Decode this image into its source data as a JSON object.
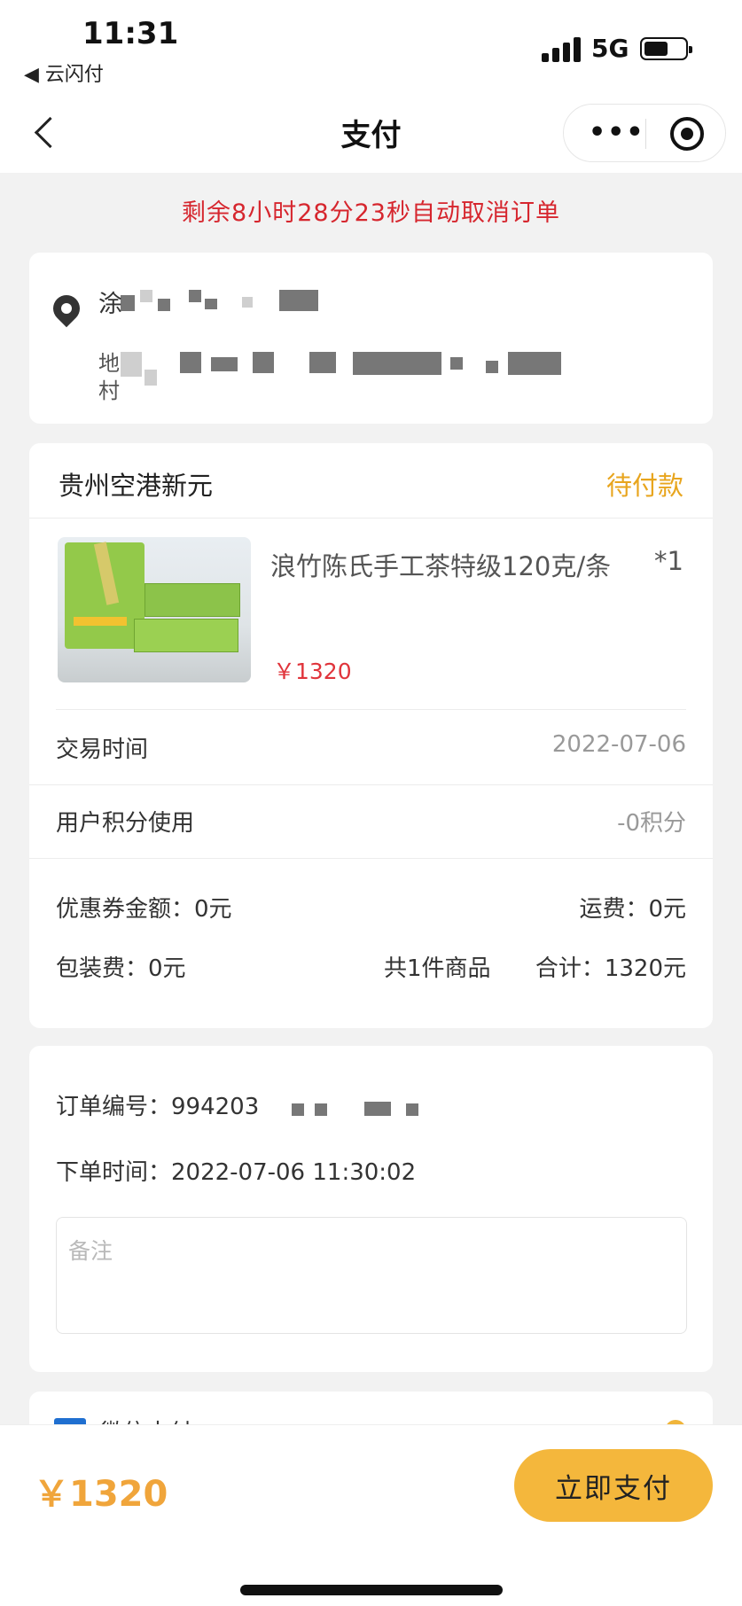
{
  "status_bar": {
    "time": "11:31",
    "back_app": "◀ 云闪付",
    "network": "5G"
  },
  "nav": {
    "title": "支付",
    "more_icon": "•••"
  },
  "countdown": "剩余8小时28分23秒自动取消订单",
  "address": {
    "name_visible": "涂",
    "line1_visible": "地",
    "line2_visible": "村"
  },
  "order": {
    "shop_name": "贵州空港新元",
    "status": "待付款",
    "product": {
      "title": "浪竹陈氏手工茶特级120克/条",
      "quantity": "*1",
      "price": "￥1320"
    },
    "rows": [
      {
        "label": "交易时间",
        "value": "2022-07-06"
      },
      {
        "label": "用户积分使用",
        "value": "-0积分"
      }
    ],
    "summary": {
      "coupon": "优惠券金额：0元",
      "shipping": "运费：0元",
      "packing": "包装费：0元",
      "item_count": "共1件商品",
      "total": "合计：1320元"
    }
  },
  "info": {
    "order_no": "订单编号：994203",
    "order_time": "下单时间：2022-07-06 11:30:02",
    "remark_placeholder": "备注"
  },
  "payment_method": {
    "label_partial": "微信支付"
  },
  "footer": {
    "total": "￥1320",
    "pay_button": "立即支付"
  },
  "colors": {
    "accent": "#f4b73c",
    "status_orange": "#e8a51e",
    "price_red": "#e0343b",
    "countdown_red": "#d6262e"
  }
}
